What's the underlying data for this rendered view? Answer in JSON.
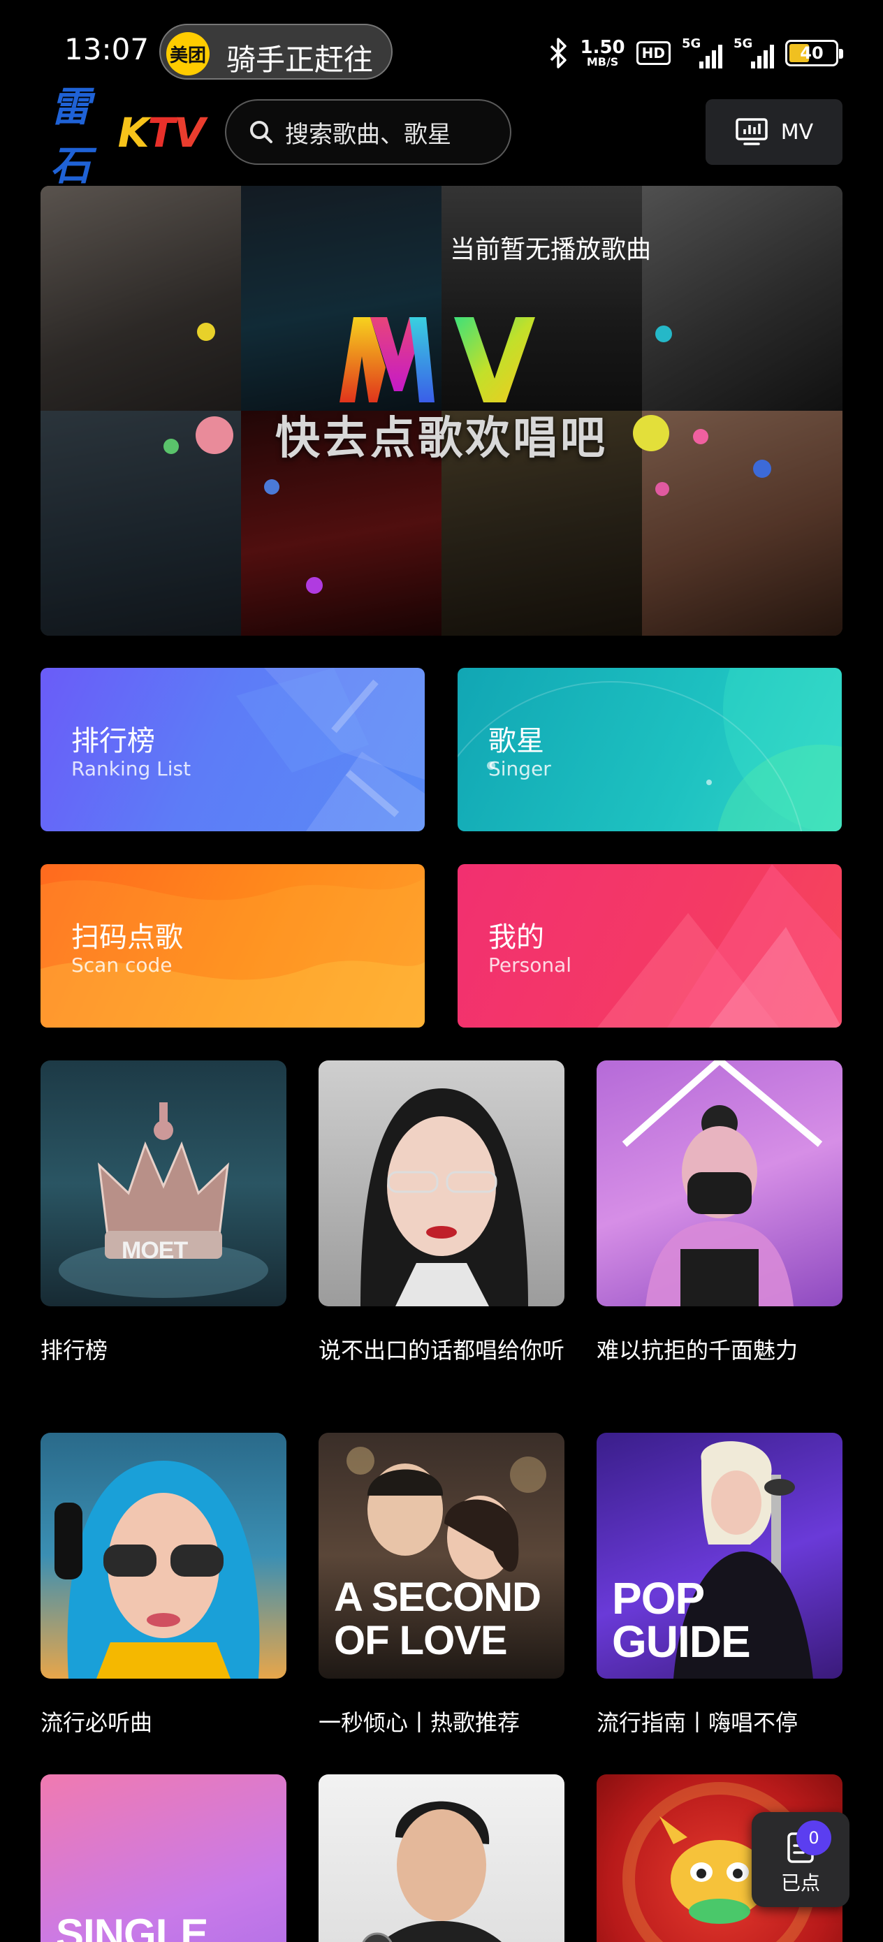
{
  "status_bar": {
    "time": "13:07",
    "notification": {
      "app_badge": "美团",
      "text": "骑手正赶往"
    },
    "net_speed_value": "1.50",
    "net_speed_unit": "MB/S",
    "hd_badge": "HD",
    "signal_1_label": "5G",
    "signal_2_label": "5G",
    "battery_level": "40"
  },
  "header": {
    "logo_cn": "雷石",
    "logo_k": "K",
    "logo_t": "T",
    "logo_v": "V",
    "search_placeholder": "搜索歌曲、歌星",
    "mv_label": "MV"
  },
  "banner": {
    "status": "当前暂无播放歌曲",
    "cta": "快去点歌欢唱吧",
    "logo_text": "MV"
  },
  "categories": [
    {
      "title": "排行榜",
      "subtitle": "Ranking List"
    },
    {
      "title": "歌星",
      "subtitle": "Singer"
    },
    {
      "title": "扫码点歌",
      "subtitle": "Scan code"
    },
    {
      "title": "我的",
      "subtitle": "Personal"
    }
  ],
  "playlists": [
    {
      "title": "排行榜",
      "cover_text": "MOET"
    },
    {
      "title": "说不出口的话都唱给你听"
    },
    {
      "title": "难以抗拒的千面魅力"
    },
    {
      "title": "流行必听曲"
    },
    {
      "title": "一秒倾心丨热歌推荐",
      "cover_text_line1": "A SECOND",
      "cover_text_line2": "OF LOVE"
    },
    {
      "title": "流行指南丨嗨唱不停",
      "cover_text_line1": "POP",
      "cover_text_line2": "GUIDE"
    },
    {
      "title": "",
      "cover_text": "SINGLE"
    },
    {
      "title": ""
    },
    {
      "title": ""
    }
  ],
  "selected_button": {
    "count": "0",
    "label": "已点"
  },
  "colors": {
    "background": "#000000",
    "accent": "#5b3ef0",
    "logo_blue": "#1f62d6"
  }
}
